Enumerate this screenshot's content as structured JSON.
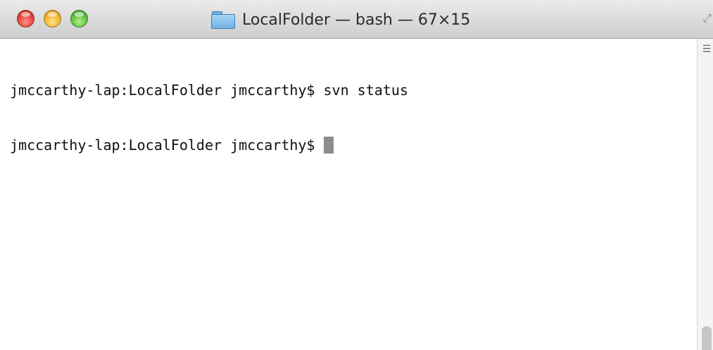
{
  "window": {
    "title": "LocalFolder — bash — 67×15"
  },
  "terminal": {
    "lines": [
      "jmccarthy-lap:LocalFolder jmccarthy$ svn status",
      "jmccarthy-lap:LocalFolder jmccarthy$ "
    ]
  },
  "icons": {
    "title": "folder-icon",
    "resize": "fullscreen-icon",
    "scroll_marker": "split-pane-icon"
  },
  "colors": {
    "close": "#e0443a",
    "minimize": "#efb32e",
    "zoom": "#5fbf3f",
    "cursor": "#8c8c8c"
  }
}
